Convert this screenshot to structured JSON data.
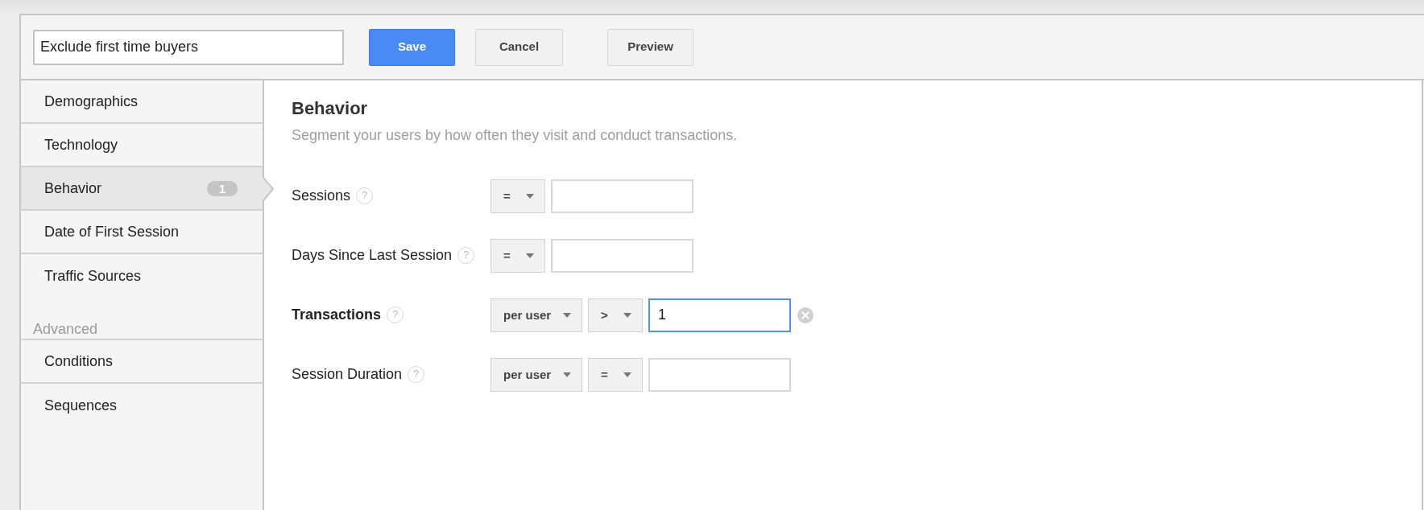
{
  "segment_name": {
    "value": "Exclude first time buyers"
  },
  "actions": [
    {
      "label": "Save",
      "kind": "primary"
    },
    {
      "label": "Cancel",
      "kind": "secondary"
    }
  ],
  "preview_button": {
    "label": "Preview"
  },
  "sidebar": {
    "items": [
      {
        "label": "Demographics",
        "selected": false
      },
      {
        "label": "Technology",
        "selected": false
      },
      {
        "label": "Behavior",
        "selected": true,
        "badge": "1"
      },
      {
        "label": "Date of First Session",
        "selected": false
      },
      {
        "label": "Traffic Sources",
        "selected": false
      }
    ],
    "advanced_heading": "Advanced",
    "advanced_items": [
      {
        "label": "Conditions",
        "selected": false
      },
      {
        "label": "Sequences",
        "selected": false
      }
    ]
  },
  "section": {
    "title": "Behavior",
    "subtitle": "Segment your users by how often they visit and conduct transactions."
  },
  "conditions": [
    {
      "label": "Sessions",
      "help": "?",
      "active": false,
      "dropdowns": [
        {
          "kind": "operator",
          "value": "="
        }
      ],
      "input": {
        "focused": false
      }
    },
    {
      "label": "Days Since Last Session",
      "help": "?",
      "active": false,
      "dropdowns": [
        {
          "kind": "operator",
          "value": "="
        }
      ],
      "input": {
        "focused": false
      }
    },
    {
      "label": "Transactions",
      "help": "?",
      "active": true,
      "dropdowns": [
        {
          "kind": "scope",
          "value": "per user"
        },
        {
          "kind": "operator",
          "value": ">"
        }
      ],
      "input": {
        "value": "1",
        "focused": true
      }
    },
    {
      "label": "Session Duration",
      "help": "?",
      "active": false,
      "dropdowns": [
        {
          "kind": "scope",
          "value": "per user"
        },
        {
          "kind": "operator",
          "value": "="
        }
      ],
      "input": {
        "focused": false
      }
    }
  ]
}
